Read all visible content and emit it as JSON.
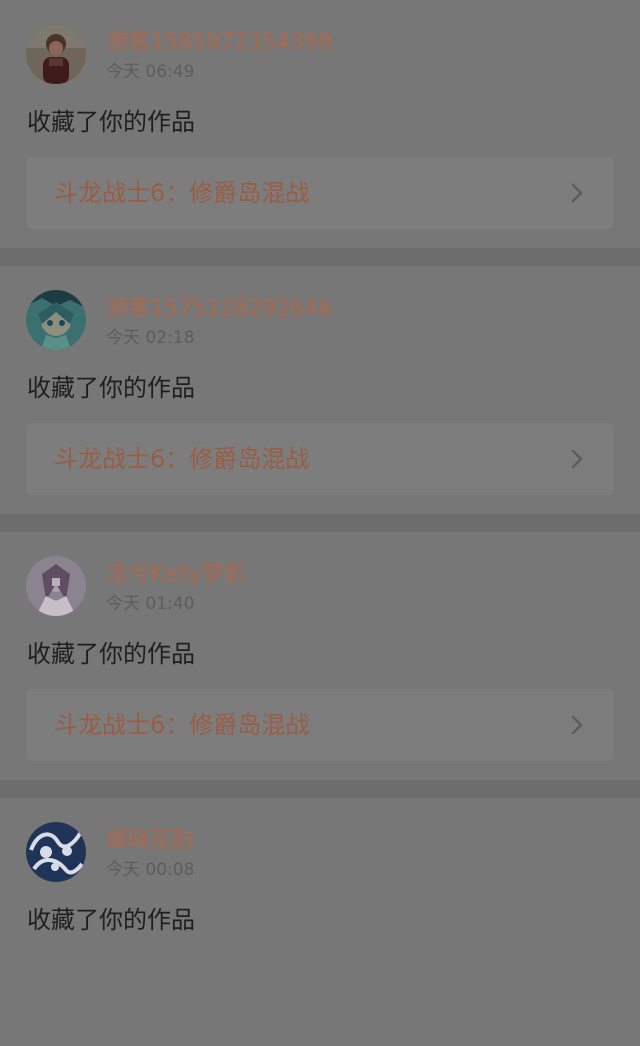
{
  "notifications": [
    {
      "username": "游客1585972354399",
      "time": "今天 06:49",
      "action": "收藏了你的作品",
      "work_title": "斗龙战士6：修爵岛混战",
      "avatar_icon": "user-avatar-icon"
    },
    {
      "username": "游客1575128292646",
      "time": "今天 02:18",
      "action": "收藏了你的作品",
      "work_title": "斗龙战士6：修爵岛混战",
      "avatar_icon": "anime-avatar-icon"
    },
    {
      "username": "凉兮Kelly梦影",
      "time": "今天 01:40",
      "action": "收藏了你的作品",
      "work_title": "斗龙战士6：修爵岛混战",
      "avatar_icon": "illustrated-avatar-icon"
    },
    {
      "username": "蝶晓花韵",
      "time": "今天 00:08",
      "action": "收藏了你的作品",
      "work_title": "",
      "avatar_icon": "blue-pattern-avatar-icon"
    }
  ],
  "colors": {
    "username": "#a8694e",
    "work_title": "#9a5d43",
    "card_background": "#777777",
    "link_background": "#7d7d7d"
  }
}
